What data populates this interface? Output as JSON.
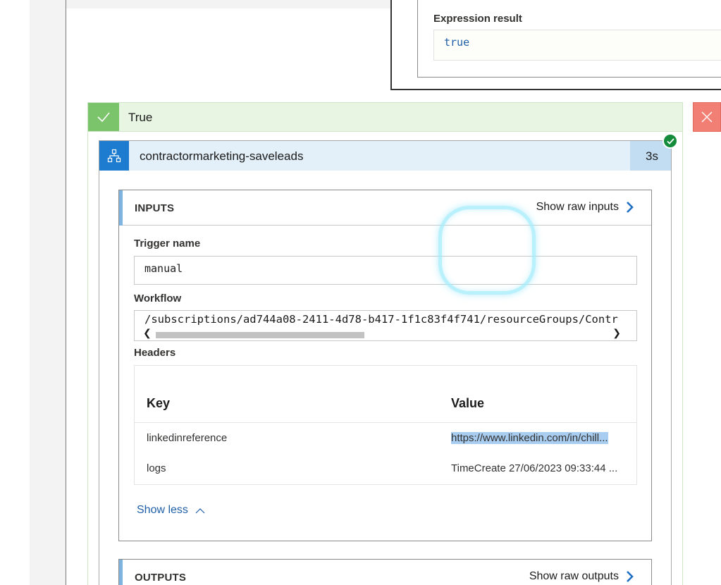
{
  "condition": {
    "expression_label": "Expression result",
    "expression_value": "true"
  },
  "branch_true": {
    "label": "True",
    "icon": "checkmark-icon"
  },
  "branch_false": {
    "icon": "close-icon"
  },
  "action": {
    "title": "contractormarketing-saveleads",
    "duration": "3s",
    "icon": "workflow-icon",
    "status_icon": "success-check-icon"
  },
  "inputs": {
    "title": "INPUTS",
    "raw_link": "Show raw inputs",
    "fields": {
      "trigger_name_label": "Trigger name",
      "trigger_name_value": "manual",
      "workflow_label": "Workflow",
      "workflow_value": "/subscriptions/ad744a08-2411-4d78-b417-1f1c83f4f741/resourceGroups/Contr",
      "headers_label": "Headers"
    },
    "headers_table": {
      "columns": [
        "Key",
        "Value"
      ],
      "rows": [
        {
          "key": "linkedinreference",
          "value": "https://www.linkedin.com/in/chill..."
        },
        {
          "key": "logs",
          "value": "TimeCreate 27/06/2023 09:33:44 ..."
        }
      ]
    },
    "show_less": "Show less"
  },
  "outputs": {
    "title": "OUTPUTS",
    "raw_link": "Show raw outputs"
  },
  "colors": {
    "true_green": "#7bc46b",
    "false_red": "#f17f74",
    "action_blue": "#1d7bd0",
    "link_blue": "#1f5fa8",
    "success_green": "#148c3c"
  }
}
